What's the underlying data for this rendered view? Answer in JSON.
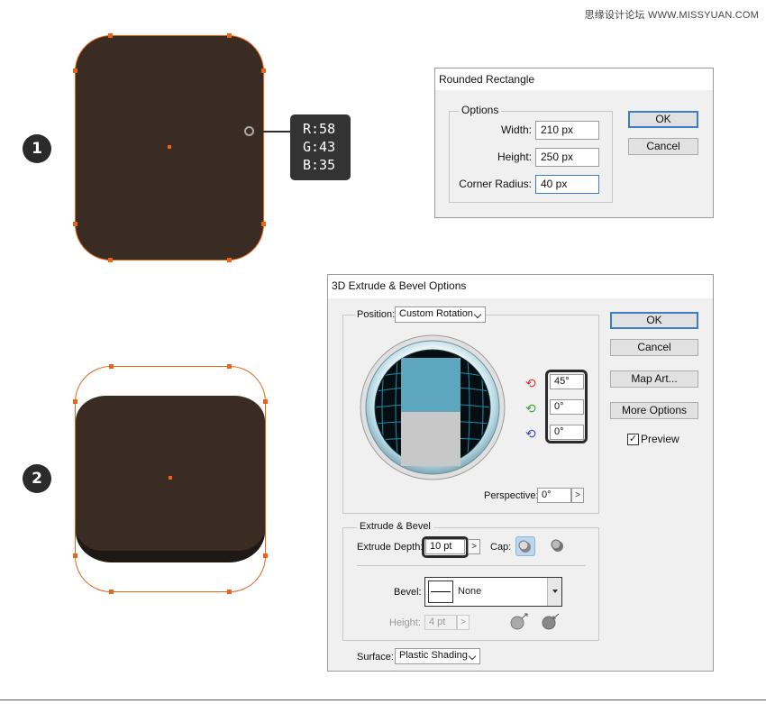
{
  "watermark": "思缘设计论坛 WWW.MISSYUAN.COM",
  "steps": {
    "one": "1",
    "two": "2"
  },
  "swatch": {
    "r": "R:58",
    "g": "G:43",
    "b": "B:35",
    "color": "#3a2b23",
    "selection_color": "#e8641b"
  },
  "rounded_rect_dialog": {
    "title": "Rounded Rectangle",
    "group_title": "Options",
    "width_label": "Width:",
    "width_value": "210 px",
    "height_label": "Height:",
    "height_value": "250 px",
    "radius_label": "Corner Radius:",
    "radius_value": "40 px",
    "ok": "OK",
    "cancel": "Cancel"
  },
  "extrude_dialog": {
    "title": "3D Extrude & Bevel Options",
    "position_label": "Position:",
    "position_value": "Custom Rotation",
    "rot_x": "45°",
    "rot_y": "0°",
    "rot_z": "0°",
    "perspective_label": "Perspective:",
    "perspective_value": "0°",
    "extrude_group": "Extrude & Bevel",
    "depth_label": "Extrude Depth:",
    "depth_value": "10 pt",
    "cap_label": "Cap:",
    "bevel_label": "Bevel:",
    "bevel_value": "None",
    "height_label": "Height:",
    "height_value": "4 pt",
    "surface_label": "Surface:",
    "surface_value": "Plastic Shading",
    "ok": "OK",
    "cancel": "Cancel",
    "map_art": "Map Art...",
    "more_options": "More Options",
    "preview_label": "Preview",
    "preview_checked": true
  }
}
